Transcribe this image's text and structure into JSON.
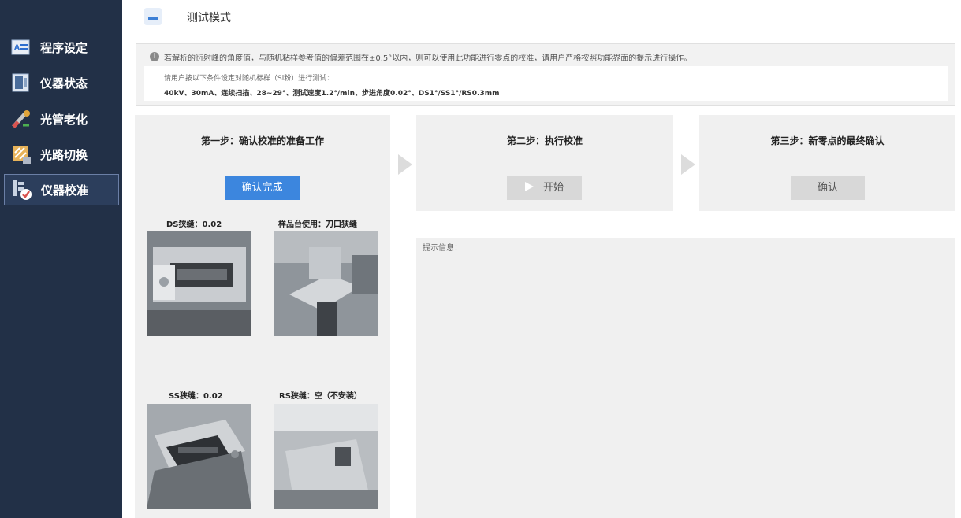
{
  "sidebar": {
    "items": [
      {
        "label": "程序设定",
        "icon": "program-icon"
      },
      {
        "label": "仪器状态",
        "icon": "status-icon"
      },
      {
        "label": "光管老化",
        "icon": "tube-icon"
      },
      {
        "label": "光路切换",
        "icon": "switch-icon"
      },
      {
        "label": "仪器校准",
        "icon": "calibration-icon"
      }
    ],
    "active_index": 4
  },
  "header": {
    "title": "测试模式",
    "icon": "mode-icon"
  },
  "notice": {
    "line1": "若解析的衍射峰的角度值，与随机粘样参考值的偏差范围在±0.5°以内，则可以使用此功能进行零点的校准，请用户严格按照功能界面的提示进行操作。",
    "param_line1": "请用户按以下条件设定对随机标样（Si粉）进行测试：",
    "param_line2": "40kV、30mA、连续扫描、28~29°、测试速度1.2°/min、步进角度0.02°、DS1°/SS1°/RS0.3mm"
  },
  "steps": [
    {
      "title": "第一步：确认校准的准备工作",
      "button": "确认完成"
    },
    {
      "title": "第二步：执行校准",
      "button": "开始"
    },
    {
      "title": "第三步：新零点的最终确认",
      "button": "确认"
    }
  ],
  "photos": [
    {
      "caption": "DS狭缝：0.02"
    },
    {
      "caption": "样品台使用：刀口狭缝"
    },
    {
      "caption": "SS狭缝：0.02"
    },
    {
      "caption": "RS狭缝：空（不安装）"
    }
  ],
  "hint": {
    "label": "提示信息："
  },
  "colors": {
    "sidebar": "#223047",
    "primary": "#3c86de",
    "panel": "#f0f0f0"
  }
}
